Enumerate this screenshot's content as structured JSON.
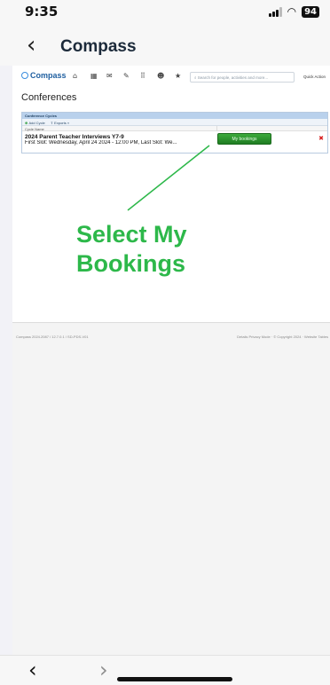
{
  "status": {
    "time": "9:35",
    "battery": "94",
    "wifi_icon": "wifi-icon",
    "signal_icon": "signal-icon"
  },
  "nav": {
    "back_icon": "chevron-left-icon",
    "back_glyph": "‹",
    "title": "Compass"
  },
  "site": {
    "logo_text": "Compass",
    "search_placeholder": "Search for people, activities and more...",
    "quick_actions": "Quick Action",
    "header_icons": [
      "home-icon",
      "calendar-icon",
      "mail-icon",
      "pencil-icon",
      "grid-icon",
      "people-icon",
      "star-icon"
    ]
  },
  "page": {
    "heading": "Conferences",
    "panel_title": "Conference Cycles",
    "toolbar": {
      "add_cycle": "Add Cycle",
      "exports": "Exports »"
    },
    "column_header": "Cycle Name",
    "row": {
      "name": "2024 Parent Teacher Interviews Y7-9",
      "slots": "First Slot: Wednesday, April 24 2024 - 12:00 PM, Last Slot: We...",
      "button": "My bookings",
      "delete_glyph": "✖"
    }
  },
  "callout": {
    "text": "Select My Bookings",
    "color": "#2db84a"
  },
  "footer": {
    "left": "Compass 2024.2087 / 12.7.0.1 / SD-PDS-V01",
    "right": "Details Privacy Mode · © Copyright 2024 · Website Tables"
  },
  "bottom": {
    "back_glyph": "‹",
    "forward_glyph": "›"
  },
  "colors": {
    "accent_green": "#2db84a",
    "button_green": "#2e8f2e",
    "panel_header_blue": "#b9d1ec",
    "delete_red": "#d81e1e"
  }
}
